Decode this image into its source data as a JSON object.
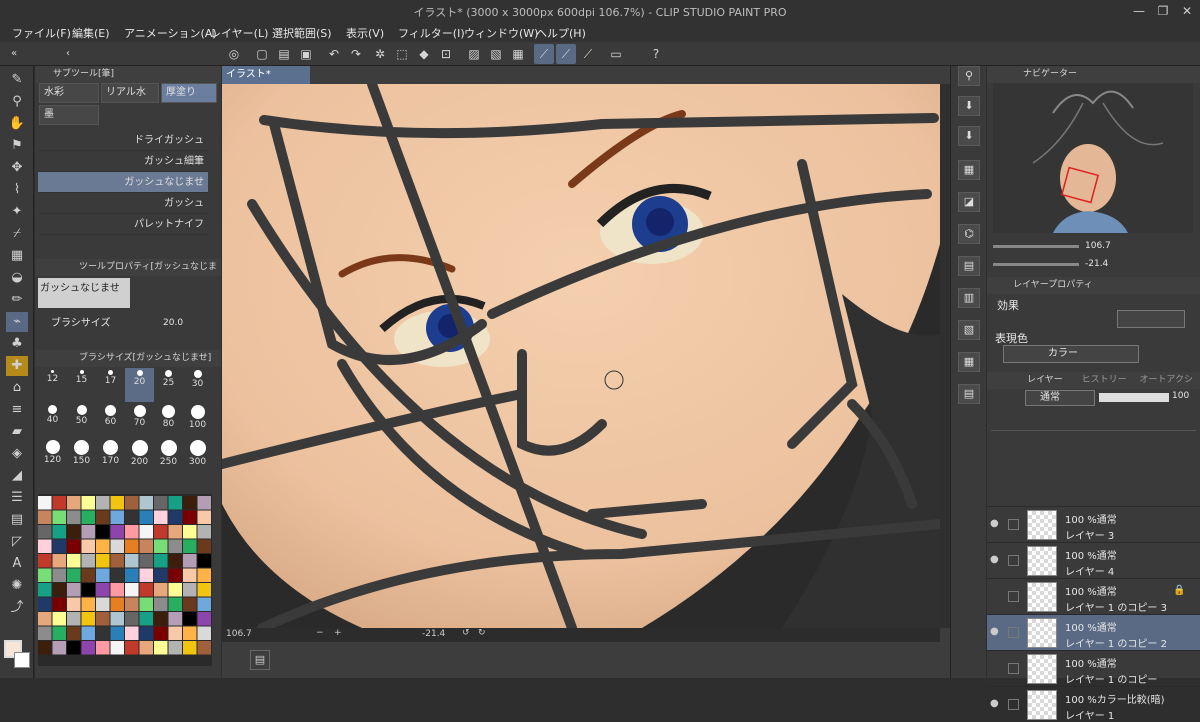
{
  "title": "イラスト* (3000 x 3000px 600dpi 106.7%)  - CLIP STUDIO PAINT PRO",
  "window_controls": [
    "—",
    "❐",
    "✕"
  ],
  "menu": [
    "ファイル(F)",
    "編集(E)",
    "アニメーション(A)",
    "レイヤー(L)",
    "選択範囲(S)",
    "表示(V)",
    "フィルター(I)",
    "ウィンドウ(W)",
    "ヘルプ(H)"
  ],
  "subtool": {
    "header": "サブツール[筆]",
    "tabs": [
      "水彩",
      "リアル水",
      "厚塗り",
      "墨"
    ],
    "brushes": [
      "ドライガッシュ",
      "ガッシュ細筆",
      "ガッシュなじませ",
      "ガッシュ",
      "パレットナイフ"
    ]
  },
  "toolprop": {
    "header": "ツールプロパティ[ガッシュなじませ]",
    "name": "ガッシュなじませ",
    "size_label": "ブラシサイズ",
    "size_value": "20.0"
  },
  "brushsize": {
    "header": "ブラシサイズ[ガッシュなじませ]",
    "sizes": [
      "12",
      "15",
      "17",
      "20",
      "25",
      "30",
      "40",
      "50",
      "60",
      "70",
      "80",
      "100",
      "120",
      "150",
      "170",
      "200",
      "250",
      "300"
    ],
    "selected": "20"
  },
  "canvas": {
    "tab": "イラスト*"
  },
  "status": {
    "zoom": "106.7",
    "angle": "-21.4"
  },
  "navigator": {
    "header": "ナビゲーター",
    "zoom": "106.7",
    "angle": "-21.4"
  },
  "layerprop": {
    "header": "レイヤープロパティ",
    "effect_label": "効果",
    "color_label": "表現色",
    "color_value": "カラー"
  },
  "layers": {
    "tabs": [
      "レイヤー",
      "ヒストリー",
      "オートアクション"
    ],
    "blend": "通常",
    "opacity": "100",
    "items": [
      {
        "mode": "100 %通常",
        "name": "レイヤー 3"
      },
      {
        "mode": "100 %通常",
        "name": "レイヤー 4"
      },
      {
        "mode": "100 %通常",
        "name": "レイヤー 1 のコピー 3"
      },
      {
        "mode": "100 %通常",
        "name": "レイヤー 1 のコピー 2"
      },
      {
        "mode": "100 %通常",
        "name": "レイヤー 1 のコピー"
      },
      {
        "mode": "100 %カラー比較(暗)",
        "name": "レイヤー 1"
      }
    ]
  },
  "colors": {
    "accent": "#5a6a85",
    "canvas_skin": "#f2c9a8",
    "line": "#3a3a3a"
  }
}
